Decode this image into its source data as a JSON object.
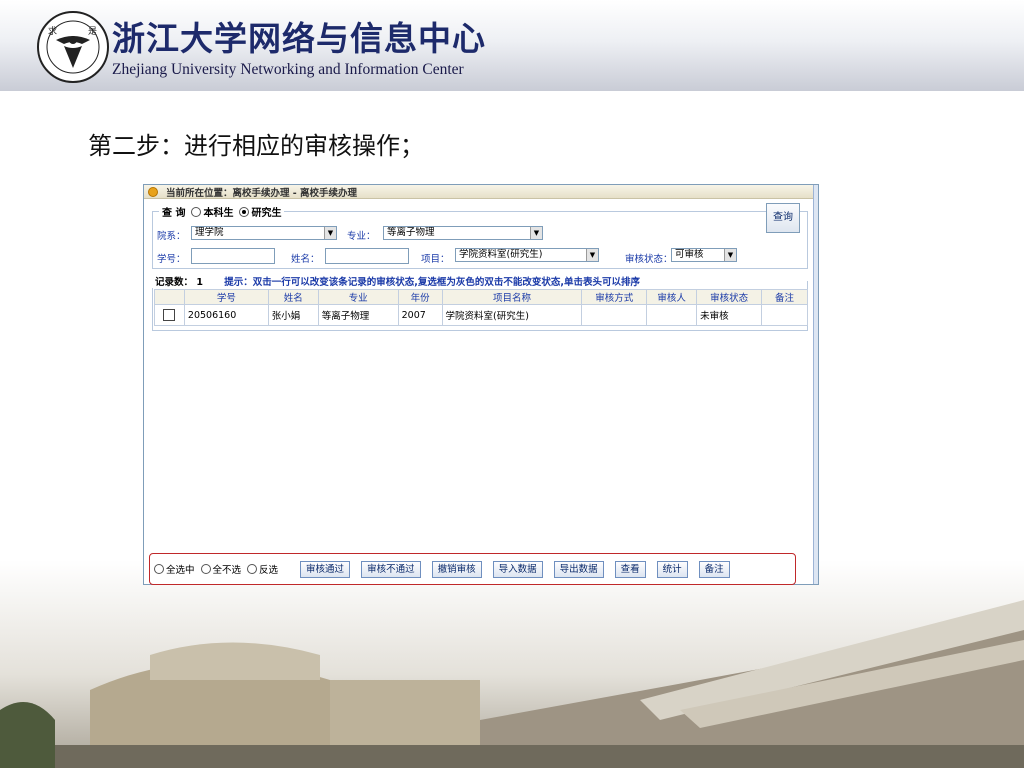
{
  "header": {
    "title_cn": "浙江大学网络与信息中心",
    "title_en": "Zhejiang University Networking and Information Center",
    "logo_text": "ZHEJIANG UNIVERSITY 1897"
  },
  "step": {
    "title": "第二步：进行相应的审核操作；"
  },
  "app": {
    "breadcrumb": "当前所在位置：离校手续办理 - 离校手续办理",
    "query": {
      "legend": "查 询",
      "type_options": [
        {
          "label": "本科生",
          "checked": false
        },
        {
          "label": "研究生",
          "checked": true
        }
      ],
      "dept_label": "院系：",
      "dept_value": "理学院",
      "major_label": "专业：",
      "major_value": "等离子物理",
      "id_label": "学号：",
      "id_value": "",
      "name_label": "姓名：",
      "name_value": "",
      "item_label": "项目：",
      "item_value": "学院资料室(研究生)",
      "status_label": "审核状态：",
      "status_value": "可审核",
      "search_button": "查询"
    },
    "results": {
      "count_label": "记录数：",
      "count_value": "1",
      "hint": "提示：双击一行可以改变该条记录的审核状态,复选框为灰色的双击不能改变状态,单击表头可以排序",
      "columns": [
        "",
        "学号",
        "姓名",
        "专业",
        "年份",
        "项目名称",
        "审核方式",
        "审核人",
        "审核状态",
        "备注"
      ],
      "rows": [
        {
          "checked": false,
          "student_id": "20506160",
          "name": "张小娟",
          "major": "等离子物理",
          "year": "2007",
          "item": "学院资料室(研究生)",
          "method": "",
          "reviewer": "",
          "status": "未审核",
          "note": ""
        }
      ]
    },
    "actions": {
      "select_options": [
        "全选中",
        "全不选",
        "反选"
      ],
      "buttons": [
        "审核通过",
        "审核不通过",
        "撤销审核",
        "导入数据",
        "导出数据",
        "查看",
        "统计",
        "备注"
      ]
    }
  },
  "colors": {
    "header_title": "#1d2a6b",
    "link_blue": "#1a3aa8",
    "highlight_border": "#c0282a"
  }
}
